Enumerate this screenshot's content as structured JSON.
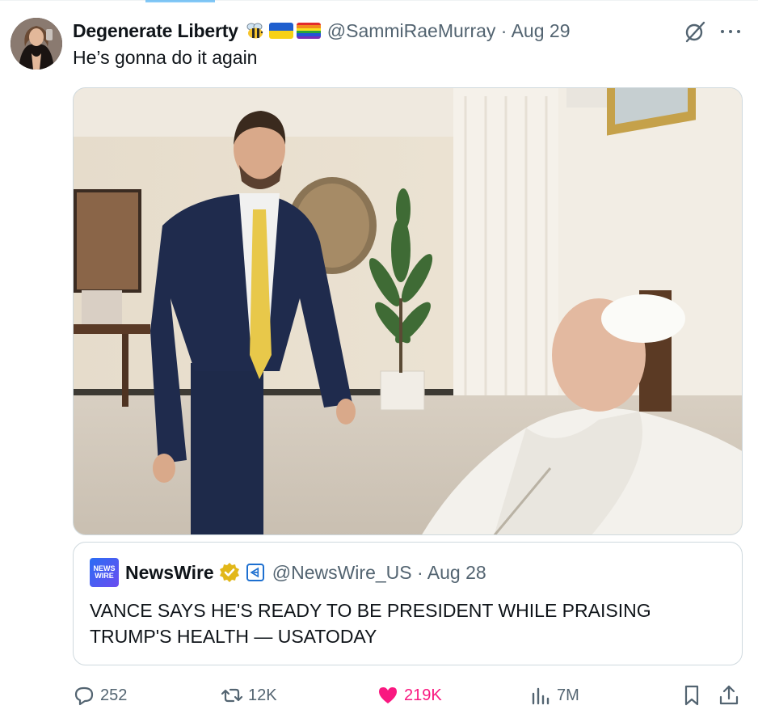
{
  "tweet": {
    "author_name": "Degenerate Liberty",
    "author_emojis": [
      "bee-icon",
      "ukraine-flag-icon",
      "pride-flag-icon"
    ],
    "handle_date": "@SammiRaeMurray · Aug 29",
    "text": "He’s gonna do it again",
    "photo_alt_icon": "photo-image"
  },
  "quote": {
    "logo_text_line1": "NEWS",
    "logo_text_line2": "WIRE",
    "name": "NewsWire",
    "verified_badge": "gold-verified-icon",
    "affiliate_icon": "affiliate-badge-icon",
    "handle_date": "@NewsWire_US · Aug 28",
    "text": "VANCE SAYS HE'S READY TO BE PRESIDENT WHILE PRAISING TRUMP'S HEALTH — USATODAY"
  },
  "actions": {
    "replies": "252",
    "reposts": "12K",
    "likes": "219K",
    "views": "7M"
  },
  "colors": {
    "accent": "#1d9bf0",
    "like": "#f91880",
    "muted": "#536471",
    "text": "#0f1419",
    "border": "#cfd9de"
  }
}
